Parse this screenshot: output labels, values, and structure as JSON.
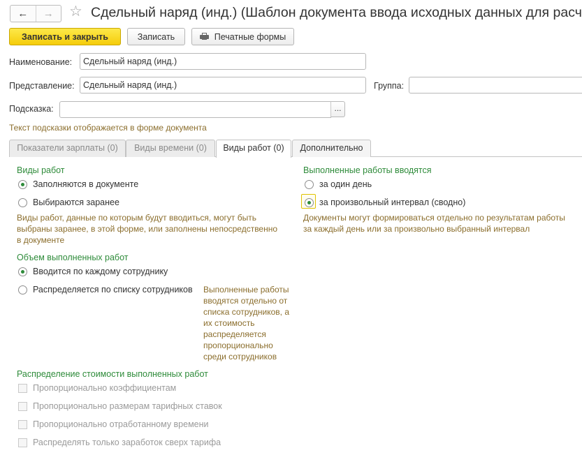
{
  "header": {
    "back_icon": "arrow-left-icon",
    "forward_icon": "arrow-right-icon",
    "favorite_icon": "star-icon",
    "title": "Сдельный наряд (инд.) (Шаблон документа ввода исходных данных для расчета"
  },
  "toolbar": {
    "save_close_label": "Записать и закрыть",
    "save_label": "Записать",
    "print_label": "Печатные формы"
  },
  "form": {
    "name_label": "Наименование:",
    "name_value": "Сдельный наряд (инд.)",
    "presentation_label": "Представление:",
    "presentation_value": "Сдельный наряд (инд.)",
    "group_label": "Группа:",
    "group_value": "",
    "hint_label": "Подсказка:",
    "hint_value": "",
    "hint_button": "...",
    "hint_note": "Текст подсказки отображается в форме документа"
  },
  "tabs": [
    {
      "label": "Показатели зарплаты (0)",
      "state": "inactive"
    },
    {
      "label": "Виды времени (0)",
      "state": "inactive"
    },
    {
      "label": "Виды работ (0)",
      "state": "active"
    },
    {
      "label": "Дополнительно",
      "state": "normal"
    }
  ],
  "work_types": {
    "title": "Виды работ",
    "options": [
      {
        "label": "Заполняются в документе",
        "selected": true
      },
      {
        "label": "Выбираются заранее",
        "selected": false
      }
    ],
    "note": "Виды работ, данные по которым будут вводиться, могут быть выбраны заранее, в этой форме, или заполнены непосредственно в документе"
  },
  "entry_period": {
    "title": "Выполненные работы вводятся",
    "options": [
      {
        "label": "за один день",
        "selected": false
      },
      {
        "label": "за произвольный интервал (сводно)",
        "selected": true
      }
    ],
    "note": "Документы могут формироваться отдельно по результатам работы за каждый день или за произвольно выбранный интервал"
  },
  "volume": {
    "title": "Объем выполненных работ",
    "options": [
      {
        "label": "Вводится по каждому сотруднику",
        "selected": true
      },
      {
        "label": "Распределяется по списку сотрудников",
        "selected": false
      }
    ],
    "note": "Выполненные работы вводятся отдельно от списка сотрудников, а их стоимость распределяется пропорционально среди сотрудников"
  },
  "distribution": {
    "title": "Распределение стоимости выполненных работ",
    "options": [
      {
        "label": "Пропорционально коэффициентам",
        "checked": false,
        "enabled": false
      },
      {
        "label": "Пропорционально размерам тарифных ставок",
        "checked": false,
        "enabled": false
      },
      {
        "label": "Пропорционально отработанному времени",
        "checked": false,
        "enabled": false
      },
      {
        "label": "Распределять только заработок сверх тарифа",
        "checked": false,
        "enabled": false
      }
    ]
  },
  "colors": {
    "primary_button": "#f5cc0a",
    "group_title": "#2e8b3a",
    "note_text": "#8b6e2d"
  }
}
